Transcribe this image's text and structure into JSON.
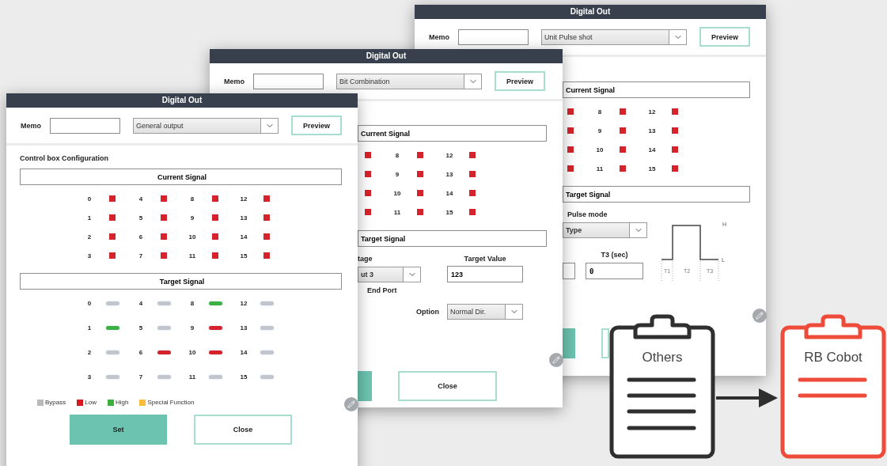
{
  "windows": [
    {
      "kind": "pulse",
      "title": "Digital Out",
      "memo_label": "Memo",
      "mode": "Unit Pulse shot",
      "preview": "Preview",
      "current_signal": {
        "title": "Current Signal",
        "ports": [
          {
            "color": "#d6232b"
          },
          {
            "color": "#d6232b"
          },
          {
            "color": "#d6232b"
          },
          {
            "color": "#d6232b"
          },
          {
            "number": "8",
            "color": "#d6232b"
          },
          {
            "number": "9",
            "color": "#d6232b"
          },
          {
            "number": "10",
            "color": "#d6232b"
          },
          {
            "number": "11",
            "color": "#d6232b"
          },
          {
            "number": "12",
            "color": "#d6232b"
          },
          {
            "number": "13",
            "color": "#d6232b"
          },
          {
            "number": "14",
            "color": "#d6232b"
          },
          {
            "number": "15",
            "color": "#d6232b"
          }
        ]
      },
      "target_signal": {
        "title": "Target Signal"
      },
      "pulse_mode_label": "Pulse mode",
      "type_select": "Type",
      "t3_label": "T3 (sec)",
      "t3_value": "0",
      "diagram": {
        "high": "H",
        "low": "L",
        "phases": [
          "T1",
          "T2",
          "T3"
        ]
      },
      "buttons": [
        {
          "kind": "primary"
        },
        {
          "kind": "outline"
        }
      ]
    },
    {
      "kind": "bit",
      "title": "Digital Out",
      "memo_label": "Memo",
      "mode": "Bit Combination",
      "preview": "Preview",
      "current_signal": {
        "title": "Current Signal",
        "ports": [
          {
            "color": "#d6232b"
          },
          {
            "color": "#d6232b"
          },
          {
            "color": "#d6232b"
          },
          {
            "color": "#d6232b"
          },
          {
            "number": "8",
            "color": "#d6232b"
          },
          {
            "number": "9",
            "color": "#d6232b"
          },
          {
            "number": "10",
            "color": "#d6232b"
          },
          {
            "number": "11",
            "color": "#d6232b"
          },
          {
            "number": "12",
            "color": "#d6232b"
          },
          {
            "number": "13",
            "color": "#d6232b"
          },
          {
            "number": "14",
            "color": "#d6232b"
          },
          {
            "number": "15",
            "color": "#d6232b"
          }
        ]
      },
      "target_signal": {
        "title": "Target Signal"
      },
      "stage_label": "tage",
      "stage_select": "ut 3",
      "target_value_label": "Target Value",
      "target_value": "123",
      "end_port_label": "End Port",
      "option_label": "Option",
      "option_select": "Normal Dir.",
      "buttons": [
        {
          "kind": "primary"
        },
        {
          "kind": "outline",
          "label": "Close"
        }
      ]
    },
    {
      "kind": "general",
      "title": "Digital Out",
      "memo_label": "Memo",
      "mode": "General output",
      "preview": "Preview",
      "section_title": "Control box Configuration",
      "current_signal": {
        "title": "Current Signal",
        "ports": [
          {
            "number": "0",
            "color": "#d6232b"
          },
          {
            "number": "1",
            "color": "#d6232b"
          },
          {
            "number": "2",
            "color": "#d6232b"
          },
          {
            "number": "3",
            "color": "#d6232b"
          },
          {
            "number": "4",
            "color": "#d6232b"
          },
          {
            "number": "5",
            "color": "#d6232b"
          },
          {
            "number": "6",
            "color": "#d6232b"
          },
          {
            "number": "7",
            "color": "#d6232b"
          },
          {
            "number": "8",
            "color": "#d6232b"
          },
          {
            "number": "9",
            "color": "#d6232b"
          },
          {
            "number": "10",
            "color": "#d6232b"
          },
          {
            "number": "11",
            "color": "#d6232b"
          },
          {
            "number": "12",
            "color": "#d6232b"
          },
          {
            "number": "13",
            "color": "#d6232b"
          },
          {
            "number": "14",
            "color": "#d6232b"
          },
          {
            "number": "15",
            "color": "#d6232b"
          }
        ]
      },
      "target_signal": {
        "title": "Target Signal",
        "ports": [
          {
            "number": "0",
            "color": "#c2c6cc"
          },
          {
            "number": "1",
            "color": "#3cb043"
          },
          {
            "number": "2",
            "color": "#c2c6cc"
          },
          {
            "number": "3",
            "color": "#c2c6cc"
          },
          {
            "number": "4",
            "color": "#c2c6cc"
          },
          {
            "number": "5",
            "color": "#c2c6cc"
          },
          {
            "number": "6",
            "color": "#d6232b"
          },
          {
            "number": "7",
            "color": "#c2c6cc"
          },
          {
            "number": "8",
            "color": "#3cb043"
          },
          {
            "number": "9",
            "color": "#d6232b"
          },
          {
            "number": "10",
            "color": "#d6232b"
          },
          {
            "number": "11",
            "color": "#c2c6cc"
          },
          {
            "number": "12",
            "color": "#c2c6cc"
          },
          {
            "number": "13",
            "color": "#c2c6cc"
          },
          {
            "number": "14",
            "color": "#c2c6cc"
          },
          {
            "number": "15",
            "color": "#c2c6cc"
          }
        ]
      },
      "legend": [
        {
          "label": "Bypass",
          "color": "#b9b9b9"
        },
        {
          "label": "Low",
          "color": "#d7191f"
        },
        {
          "label": "High",
          "color": "#3fae3f"
        },
        {
          "label": "Special Function",
          "color": "#fbbd3a"
        }
      ],
      "buttons": [
        {
          "kind": "primary",
          "label": "Set"
        },
        {
          "kind": "outline",
          "label": "Close"
        }
      ]
    }
  ],
  "clipboards": [
    {
      "kind": "source",
      "label": "Others",
      "color": "#2f2f2f"
    },
    {
      "kind": "target",
      "label": "RB Cobot",
      "color": "#ee4b3a"
    }
  ]
}
